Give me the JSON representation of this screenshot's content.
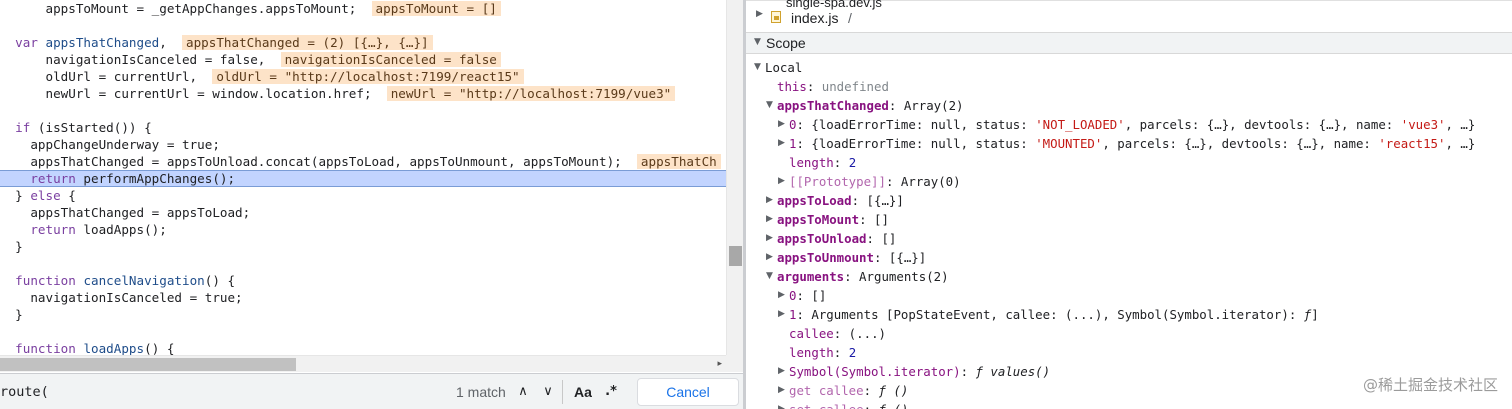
{
  "editor": {
    "lines": [
      {
        "indent": "    ",
        "text": "appsToMount = _getAppChanges.appsToMount;",
        "inline": "appsToMount = []"
      },
      {
        "text": ""
      },
      {
        "tokens": [
          {
            "k": "kw",
            "t": "var"
          },
          {
            "t": " "
          },
          {
            "k": "vr",
            "t": "appsThatChanged"
          },
          {
            "t": ","
          }
        ],
        "inline": "appsThatChanged = (2) [{…}, {…}]"
      },
      {
        "indent": "    ",
        "text": "navigationIsCanceled = false,",
        "inline": "navigationIsCanceled = false"
      },
      {
        "indent": "    ",
        "text": "oldUrl = currentUrl,",
        "inline": "oldUrl = \"http://localhost:7199/react15\""
      },
      {
        "indent": "    ",
        "text": "newUrl = currentUrl = window.location.href;",
        "inline": "newUrl = \"http://localhost:7199/vue3\""
      },
      {
        "text": ""
      },
      {
        "tokens": [
          {
            "k": "kw",
            "t": "if"
          },
          {
            "t": " (isStarted()) {"
          }
        ]
      },
      {
        "indent": "  ",
        "text": "appChangeUnderway = true;"
      },
      {
        "indent": "  ",
        "text": "appsThatChanged = appsToUnload.concat(appsToLoad, appsToUnmount, appsToMount);",
        "inline": "appsThatCh"
      },
      {
        "indent": "  ",
        "tokens": [
          {
            "k": "kw",
            "t": "return"
          },
          {
            "t": " performAppChanges();"
          }
        ],
        "paused": true
      },
      {
        "tokens": [
          {
            "t": "} "
          },
          {
            "k": "kw",
            "t": "else"
          },
          {
            "t": " {"
          }
        ]
      },
      {
        "indent": "  ",
        "text": "appsThatChanged = appsToLoad;"
      },
      {
        "indent": "  ",
        "tokens": [
          {
            "k": "kw",
            "t": "return"
          },
          {
            "t": " loadApps();"
          }
        ]
      },
      {
        "text": "}"
      },
      {
        "text": ""
      },
      {
        "tokens": [
          {
            "k": "kw",
            "t": "function"
          },
          {
            "t": " "
          },
          {
            "k": "fn",
            "t": "cancelNavigation"
          },
          {
            "t": "() {"
          }
        ]
      },
      {
        "indent": "  ",
        "text": "navigationIsCanceled = true;"
      },
      {
        "text": "}"
      },
      {
        "text": ""
      },
      {
        "tokens": [
          {
            "k": "kw",
            "t": "function"
          },
          {
            "t": " "
          },
          {
            "k": "fn",
            "t": "loadApps"
          },
          {
            "t": "() {"
          }
        ]
      }
    ],
    "hscroll_arrow": "▸"
  },
  "search": {
    "value": "route(",
    "match_count": "1 match",
    "prev_icon": "∧",
    "next_icon": "∨",
    "match_case_label": "Aa",
    "regex_label": ".*",
    "cancel_label": "Cancel"
  },
  "sidebar": {
    "partial_file": "single-spa.dev.js",
    "file_name": "index.js",
    "file_slash": "/",
    "scope_title": "Scope",
    "rows": [
      {
        "depth": 0,
        "tri": "▼",
        "parts": [
          {
            "t": "Local"
          }
        ]
      },
      {
        "depth": 1,
        "tri": "",
        "parts": [
          {
            "c": "pname-plain",
            "t": "this"
          },
          {
            "t": ": "
          },
          {
            "c": "gray",
            "t": "undefined"
          }
        ]
      },
      {
        "depth": 1,
        "tri": "▼",
        "parts": [
          {
            "c": "pname",
            "t": "appsThatChanged"
          },
          {
            "t": ": Array(2)"
          }
        ]
      },
      {
        "depth": 2,
        "tri": "▶",
        "parts": [
          {
            "c": "pname-plain",
            "t": "0"
          },
          {
            "t": ": {loadErrorTime: null, status: "
          },
          {
            "c": "str",
            "t": "'NOT_LOADED'"
          },
          {
            "t": ", parcels: {…}, devtools: {…}, name: "
          },
          {
            "c": "str",
            "t": "'vue3'"
          },
          {
            "t": ", …}"
          }
        ]
      },
      {
        "depth": 2,
        "tri": "▶",
        "parts": [
          {
            "c": "pname-plain",
            "t": "1"
          },
          {
            "t": ": {loadErrorTime: null, status: "
          },
          {
            "c": "str",
            "t": "'MOUNTED'"
          },
          {
            "t": ", parcels: {…}, devtools: {…}, name: "
          },
          {
            "c": "str",
            "t": "'react15'"
          },
          {
            "t": ", …}"
          }
        ]
      },
      {
        "depth": 2,
        "tri": "",
        "parts": [
          {
            "c": "pname-plain",
            "t": "length"
          },
          {
            "t": ": "
          },
          {
            "c": "num",
            "t": "2"
          }
        ]
      },
      {
        "depth": 2,
        "tri": "▶",
        "parts": [
          {
            "c": "pdim",
            "t": "[[Prototype]]"
          },
          {
            "t": ": Array(0)"
          }
        ]
      },
      {
        "depth": 1,
        "tri": "▶",
        "parts": [
          {
            "c": "pname",
            "t": "appsToLoad"
          },
          {
            "t": ": [{…}]"
          }
        ]
      },
      {
        "depth": 1,
        "tri": "▶",
        "parts": [
          {
            "c": "pname",
            "t": "appsToMount"
          },
          {
            "t": ": []"
          }
        ]
      },
      {
        "depth": 1,
        "tri": "▶",
        "parts": [
          {
            "c": "pname",
            "t": "appsToUnload"
          },
          {
            "t": ": []"
          }
        ]
      },
      {
        "depth": 1,
        "tri": "▶",
        "parts": [
          {
            "c": "pname",
            "t": "appsToUnmount"
          },
          {
            "t": ": [{…}]"
          }
        ]
      },
      {
        "depth": 1,
        "tri": "▼",
        "parts": [
          {
            "c": "pname",
            "t": "arguments"
          },
          {
            "t": ": Arguments(2)"
          }
        ]
      },
      {
        "depth": 2,
        "tri": "▶",
        "parts": [
          {
            "c": "pname-plain",
            "t": "0"
          },
          {
            "t": ": []"
          }
        ]
      },
      {
        "depth": 2,
        "tri": "▶",
        "parts": [
          {
            "c": "pname-plain",
            "t": "1"
          },
          {
            "t": ": Arguments [PopStateEvent, callee: (...), Symbol(Symbol.iterator): "
          },
          {
            "c": "ital",
            "t": "ƒ"
          },
          {
            "t": "]"
          }
        ]
      },
      {
        "depth": 2,
        "tri": "",
        "parts": [
          {
            "c": "pname-plain",
            "t": "callee"
          },
          {
            "t": ": (...)"
          }
        ]
      },
      {
        "depth": 2,
        "tri": "",
        "parts": [
          {
            "c": "pname-plain",
            "t": "length"
          },
          {
            "t": ": "
          },
          {
            "c": "num",
            "t": "2"
          }
        ]
      },
      {
        "depth": 2,
        "tri": "▶",
        "parts": [
          {
            "c": "pname-plain",
            "t": "Symbol(Symbol.iterator)"
          },
          {
            "t": ": "
          },
          {
            "c": "ital",
            "t": "ƒ values()"
          }
        ]
      },
      {
        "depth": 2,
        "tri": "▶",
        "parts": [
          {
            "c": "pdim",
            "t": "get callee"
          },
          {
            "t": ": "
          },
          {
            "c": "ital",
            "t": "ƒ ()"
          }
        ]
      },
      {
        "depth": 2,
        "tri": "▶",
        "parts": [
          {
            "c": "pdim",
            "t": "set callee"
          },
          {
            "t": ": "
          },
          {
            "c": "ital",
            "t": "ƒ ()"
          }
        ]
      }
    ]
  },
  "watermark": "@稀土掘金技术社区"
}
